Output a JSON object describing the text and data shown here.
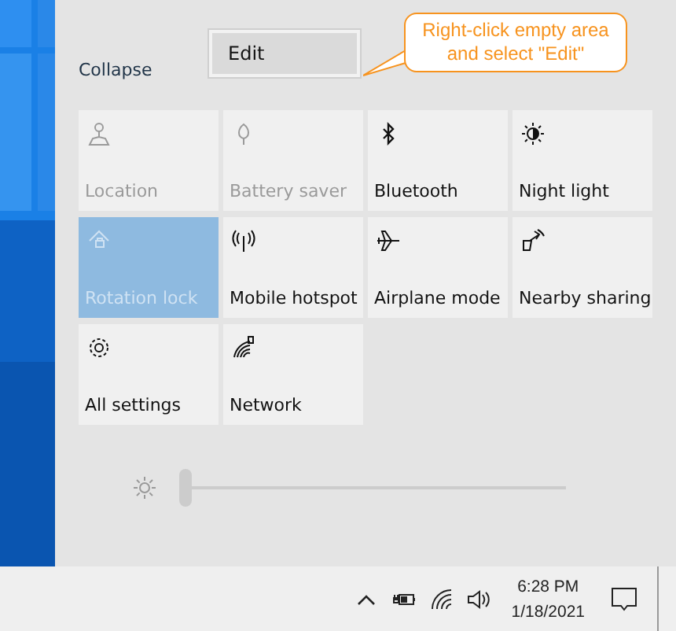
{
  "header": {
    "collapse": "Collapse"
  },
  "context_menu": {
    "items": [
      {
        "label": "Edit",
        "selected": true
      }
    ]
  },
  "callout": {
    "text": "Right-click empty area and select \"Edit\""
  },
  "tiles": [
    {
      "label": "Location",
      "on": false,
      "disabled": true
    },
    {
      "label": "Battery saver",
      "on": false,
      "disabled": true
    },
    {
      "label": "Bluetooth",
      "on": false,
      "disabled": false
    },
    {
      "label": "Night light",
      "on": false,
      "disabled": false
    },
    {
      "label": "Rotation lock",
      "on": true,
      "disabled": false
    },
    {
      "label": "Mobile hotspot",
      "on": false,
      "disabled": false
    },
    {
      "label": "Airplane mode",
      "on": false,
      "disabled": false
    },
    {
      "label": "Nearby sharing",
      "on": false,
      "disabled": false
    },
    {
      "label": "All settings",
      "on": false,
      "disabled": false
    },
    {
      "label": "Network",
      "on": false,
      "disabled": false
    }
  ],
  "brightness": {
    "level": 0
  },
  "taskbar": {
    "time": "6:28 PM",
    "date": "1/18/2021"
  }
}
